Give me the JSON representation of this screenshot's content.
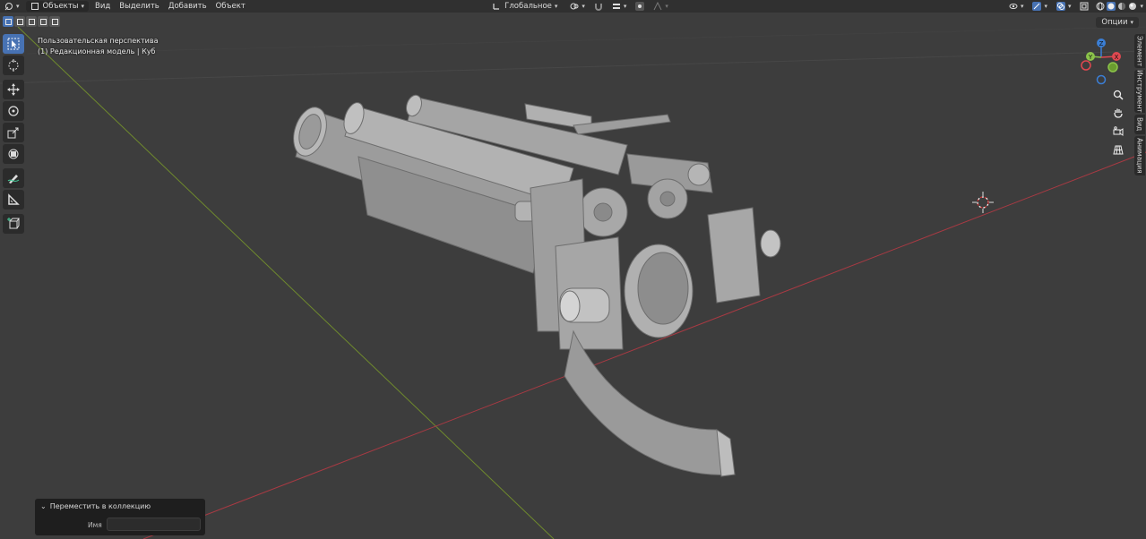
{
  "header": {
    "mode": "Объекты",
    "menus": [
      "Вид",
      "Выделить",
      "Добавить",
      "Объект"
    ],
    "transform_orientation": "Глобальное"
  },
  "options_label": "Опции",
  "viewport": {
    "perspective": "Пользовательская перспектива",
    "collection_line": "(1) Редакционная модель | Куб"
  },
  "gizmo": {
    "z": "Z",
    "y": "Y",
    "x": "X"
  },
  "npanel_tabs": [
    "Элемент",
    "Инструмент",
    "Вид",
    "Анимация"
  ],
  "operator_panel": {
    "title": "Переместить в коллекцию",
    "field_label": "Имя",
    "field_value": ""
  },
  "colors": {
    "accent": "#4772b3",
    "axis_x": "#e04850",
    "axis_y": "#8bc34a",
    "axis_z": "#3b7fd6",
    "background": "#3d3d3d"
  }
}
